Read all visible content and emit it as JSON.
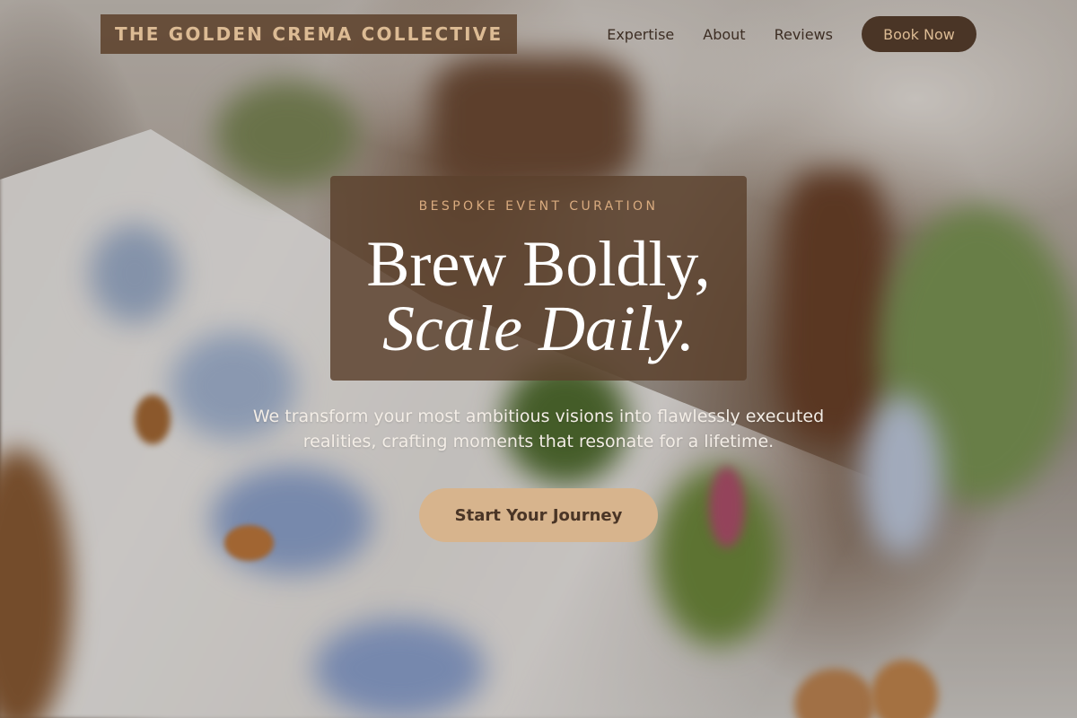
{
  "header": {
    "brand": "THE GOLDEN CREMA COLLECTIVE",
    "nav": [
      {
        "label": "Expertise"
      },
      {
        "label": "About"
      },
      {
        "label": "Reviews"
      }
    ],
    "book_button": "Book Now"
  },
  "hero": {
    "eyebrow": "BESPOKE EVENT CURATION",
    "headline_line1": "Brew Boldly,",
    "headline_line2": "Scale Daily.",
    "subtitle": "We transform your most ambitious visions into flawlessly executed realities, crafting moments that resonate for a lifetime.",
    "cta_label": "Start Your Journey"
  },
  "colors": {
    "brand_bg": "#5c402a",
    "brand_text": "#dcbb94",
    "button_dark": "#4a3526",
    "cta_bg": "#d7b48d",
    "eyebrow": "#d9ab7f"
  }
}
